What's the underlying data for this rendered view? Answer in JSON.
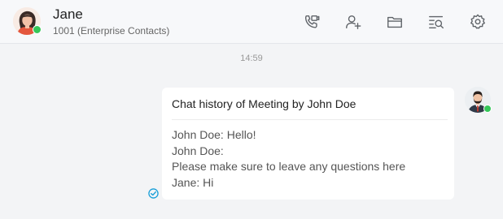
{
  "contact": {
    "name": "Jane",
    "subtitle": "1001  (Enterprise Contacts)",
    "presence_color": "#35c759"
  },
  "toolbar": {
    "buttons": [
      {
        "icon": "video-call-icon"
      },
      {
        "icon": "add-contact-icon"
      },
      {
        "icon": "folder-icon"
      },
      {
        "icon": "search-history-icon"
      },
      {
        "icon": "settings-gear-icon"
      }
    ]
  },
  "chat": {
    "timestamp": "14:59",
    "message": {
      "title": "Chat history of Meeting by John Doe",
      "lines": [
        "John Doe: Hello!",
        "John Doe:",
        "Please make sure to leave any questions here",
        "Jane: Hi"
      ],
      "status_icon": "read-check-icon",
      "sender_avatar": "john-doe-avatar"
    }
  },
  "colors": {
    "accent": "#1a9fd8",
    "online": "#35c759",
    "icon": "#5f6368"
  }
}
